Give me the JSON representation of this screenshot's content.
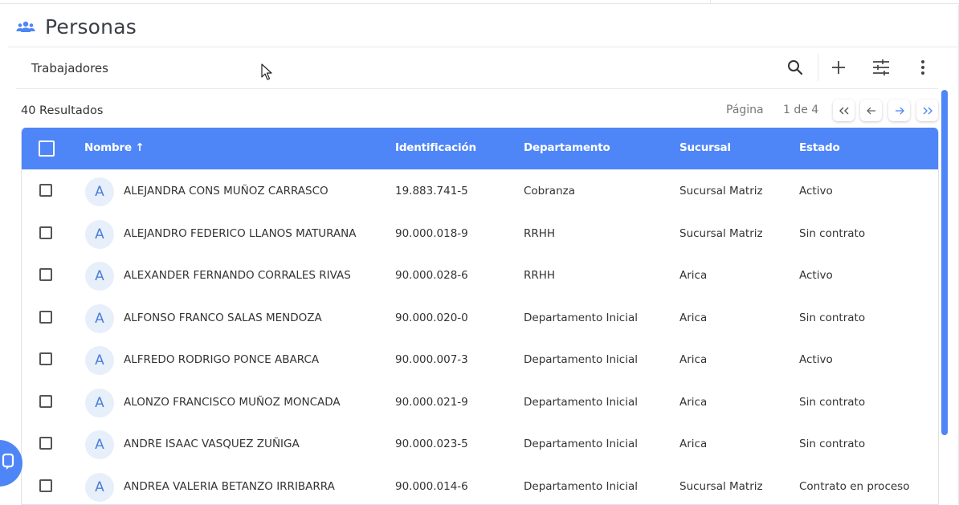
{
  "page": {
    "title": "Personas",
    "icon": "people-group-icon"
  },
  "toolbar": {
    "label": "Trabajadores",
    "actions": [
      {
        "name": "search",
        "icon": "search-icon"
      },
      {
        "name": "add",
        "icon": "plus-icon"
      },
      {
        "name": "filters",
        "icon": "sliders-icon"
      },
      {
        "name": "more",
        "icon": "more-vertical-icon"
      }
    ]
  },
  "results": {
    "text": "40 Resultados"
  },
  "pagination": {
    "page_label": "Página",
    "page_count": "1 de 4",
    "buttons": [
      {
        "name": "first",
        "glyph": "«"
      },
      {
        "name": "previous",
        "glyph": "←"
      },
      {
        "name": "next",
        "glyph": "→"
      },
      {
        "name": "last",
        "glyph": "»"
      }
    ]
  },
  "table": {
    "columns": [
      "Nombre",
      "Identificación",
      "Departamento",
      "Sucursal",
      "Estado"
    ],
    "sort_indicator": "↑",
    "rows": [
      {
        "initial": "A",
        "nombre": "ALEJANDRA CONS MUÑOZ CARRASCO",
        "identificacion": "19.883.741-5",
        "departamento": "Cobranza",
        "sucursal": "Sucursal Matriz",
        "estado": "Activo"
      },
      {
        "initial": "A",
        "nombre": "ALEJANDRO FEDERICO LLANOS MATURANA",
        "identificacion": "90.000.018-9",
        "departamento": "RRHH",
        "sucursal": "Sucursal Matriz",
        "estado": "Sin contrato"
      },
      {
        "initial": "A",
        "nombre": "ALEXANDER FERNANDO CORRALES RIVAS",
        "identificacion": "90.000.028-6",
        "departamento": "RRHH",
        "sucursal": "Arica",
        "estado": "Activo"
      },
      {
        "initial": "A",
        "nombre": "ALFONSO FRANCO SALAS MENDOZA",
        "identificacion": "90.000.020-0",
        "departamento": "Departamento Inicial",
        "sucursal": "Arica",
        "estado": "Sin contrato"
      },
      {
        "initial": "A",
        "nombre": "ALFREDO RODRIGO PONCE ABARCA",
        "identificacion": "90.000.007-3",
        "departamento": "Departamento Inicial",
        "sucursal": "Arica",
        "estado": "Activo"
      },
      {
        "initial": "A",
        "nombre": "ALONZO FRANCISCO MUÑOZ MONCADA",
        "identificacion": "90.000.021-9",
        "departamento": "Departamento Inicial",
        "sucursal": "Arica",
        "estado": "Sin contrato"
      },
      {
        "initial": "A",
        "nombre": "ANDRE ISAAC VASQUEZ ZUÑIGA",
        "identificacion": "90.000.023-5",
        "departamento": "Departamento Inicial",
        "sucursal": "Arica",
        "estado": "Sin contrato"
      },
      {
        "initial": "A",
        "nombre": "ANDREA VALERIA BETANZO IRRIBARRA",
        "identificacion": "90.000.014-6",
        "departamento": "Departamento Inicial",
        "sucursal": "Sucursal Matriz",
        "estado": "Contrato en proceso"
      }
    ]
  },
  "colors": {
    "accent": "#4f86f7",
    "avatar_bg": "#e7effb",
    "avatar_text": "#4a7fd8"
  }
}
